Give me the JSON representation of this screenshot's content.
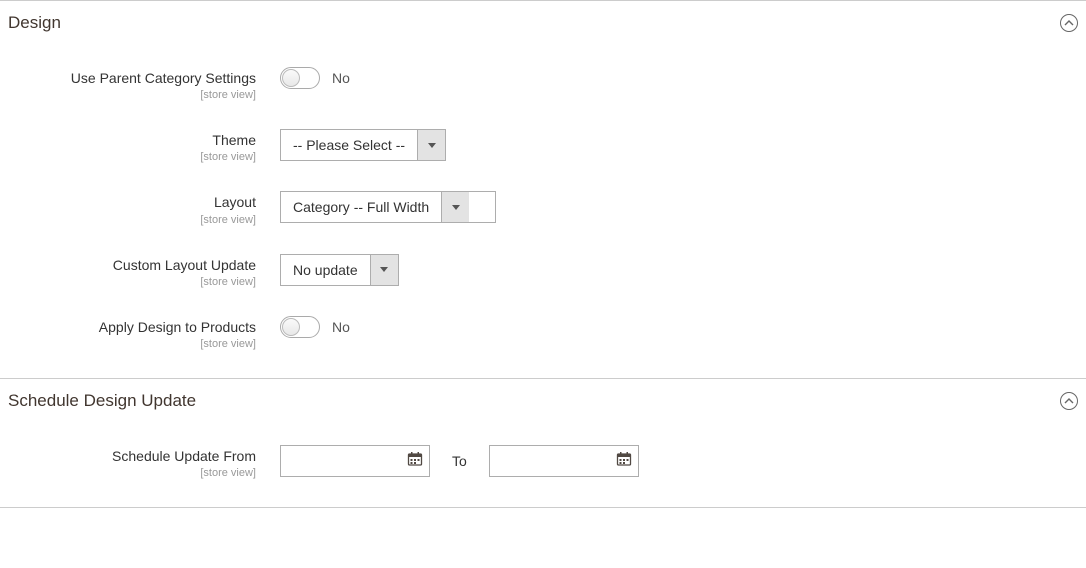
{
  "sections": {
    "design": {
      "title": "Design",
      "fields": {
        "use_parent": {
          "label": "Use Parent Category Settings",
          "scope": "[store view]",
          "value_text": "No"
        },
        "theme": {
          "label": "Theme",
          "scope": "[store view]",
          "value": "-- Please Select --"
        },
        "layout": {
          "label": "Layout",
          "scope": "[store view]",
          "value": "Category -- Full Width"
        },
        "custom_layout_update": {
          "label": "Custom Layout Update",
          "scope": "[store view]",
          "value": "No update"
        },
        "apply_to_products": {
          "label": "Apply Design to Products",
          "scope": "[store view]",
          "value_text": "No"
        }
      }
    },
    "schedule": {
      "title": "Schedule Design Update",
      "fields": {
        "from": {
          "label": "Schedule Update From",
          "scope": "[store view]",
          "from_value": "",
          "to_label": "To",
          "to_value": ""
        }
      }
    }
  }
}
